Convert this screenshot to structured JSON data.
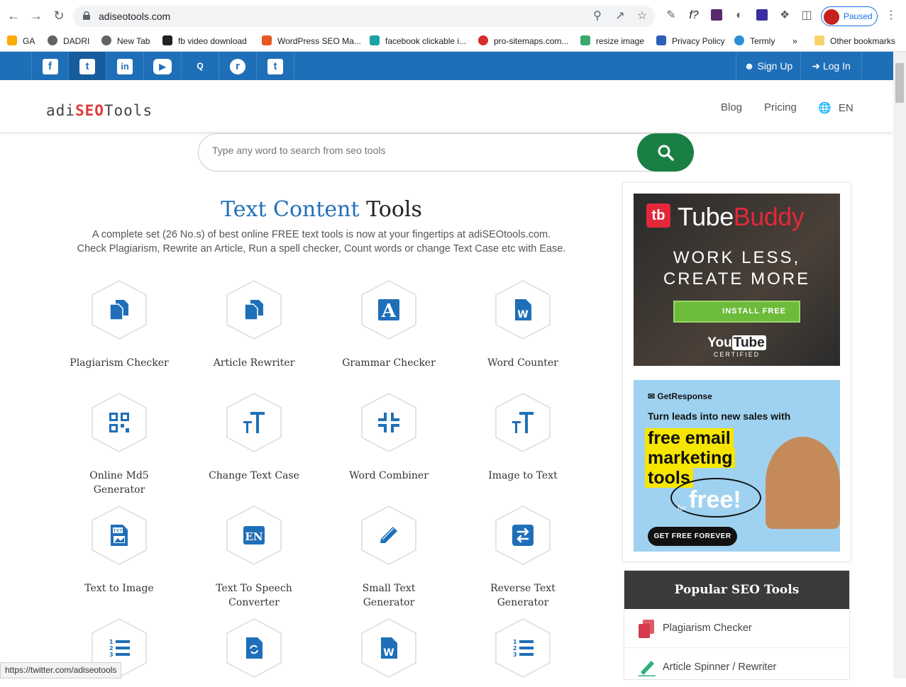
{
  "browser": {
    "url": "adiseotools.com",
    "profile_status": "Paused",
    "bookmarks": [
      {
        "label": "GA"
      },
      {
        "label": "DADRI"
      },
      {
        "label": "New Tab"
      },
      {
        "label": "fb video download"
      },
      {
        "label": "WordPress SEO Ma..."
      },
      {
        "label": "facebook clickable i..."
      },
      {
        "label": "pro-sitemaps.com..."
      },
      {
        "label": "resize image"
      },
      {
        "label": "Privacy Policy"
      },
      {
        "label": "Termly"
      },
      {
        "label": "»"
      },
      {
        "label": "Other bookmarks"
      }
    ]
  },
  "social": {
    "items": [
      "f",
      "t",
      "in",
      "▶",
      "Q",
      "r",
      "t"
    ],
    "signup": "Sign Up",
    "login": "Log In"
  },
  "header": {
    "logo_pre": "adi",
    "logo_seo": "SEO",
    "logo_post": "Tools",
    "nav": [
      "Blog",
      "Pricing",
      "EN"
    ]
  },
  "search": {
    "placeholder": "Type any word to search from seo tools"
  },
  "main": {
    "title_blue": "Text Content",
    "title_rest": " Tools",
    "desc_line1": "A complete set (26 No.s) of best online FREE text tools is now at your fingertips at adiSEOtools.com.",
    "desc_line2": "Check Plagiarism, Rewrite an Article, Run a spell checker, Count words or change Text Case etc with Ease.",
    "tools": [
      {
        "label": "Plagiarism Checker",
        "icon": "copy-icon"
      },
      {
        "label": "Article Rewriter",
        "icon": "copy-icon"
      },
      {
        "label": "Grammar Checker",
        "icon": "letter-a-icon"
      },
      {
        "label": "Word Counter",
        "icon": "word-doc-icon"
      },
      {
        "label": "Online Md5 Generator",
        "icon": "qr-code-icon"
      },
      {
        "label": "Change Text Case",
        "icon": "text-height-icon"
      },
      {
        "label": "Word Combiner",
        "icon": "compress-icon"
      },
      {
        "label": "Image to Text",
        "icon": "text-height-icon"
      },
      {
        "label": "Text to Image",
        "icon": "txt-file-icon"
      },
      {
        "label": "Text To Speech Converter",
        "icon": "language-icon"
      },
      {
        "label": "Small Text Generator",
        "icon": "pencil-icon"
      },
      {
        "label": "Reverse Text Generator",
        "icon": "exchange-icon"
      },
      {
        "label": "",
        "icon": "ordered-list-icon"
      },
      {
        "label": "",
        "icon": "file-sync-icon"
      },
      {
        "label": "",
        "icon": "word-doc-icon"
      },
      {
        "label": "",
        "icon": "ordered-list-icon"
      }
    ]
  },
  "ads": {
    "tubebuddy": {
      "brand_a": "Tube",
      "brand_b": "Buddy",
      "line1": "WORK LESS,",
      "line2": "CREATE MORE",
      "cta": "INSTALL FREE",
      "badge_a": "You",
      "badge_b": "Tube",
      "badge_c": "CERTIFIED"
    },
    "getresponse": {
      "brand": "GetResponse",
      "headline": "Turn leads into new sales with",
      "hl1": "free email",
      "hl2": "marketing",
      "hl3": "tools",
      "for": "for",
      "free": "free!",
      "cta": "GET FREE FOREVER"
    }
  },
  "popular": {
    "title": "Popular SEO Tools",
    "items": [
      "Plagiarism Checker",
      "Article Spinner / Rewriter"
    ]
  },
  "status_url": "https://twitter.com/adiseotools"
}
